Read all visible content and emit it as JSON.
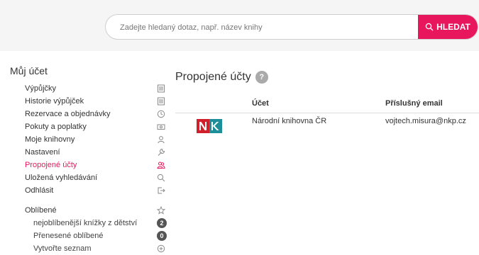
{
  "search": {
    "placeholder": "Zadejte hledaný dotaz, např. název knihy",
    "button_label": "HLEDAT"
  },
  "account": {
    "title": "Můj účet",
    "menu": [
      {
        "label": "Výpůjčky",
        "icon": "ledger-icon",
        "active": false
      },
      {
        "label": "Historie výpůjček",
        "icon": "ledger-icon",
        "active": false
      },
      {
        "label": "Rezervace a objednávky",
        "icon": "clock-icon",
        "active": false
      },
      {
        "label": "Pokuty a poplatky",
        "icon": "banknote-icon",
        "active": false
      },
      {
        "label": "Moje knihovny",
        "icon": "user-icon",
        "active": false
      },
      {
        "label": "Nastavení",
        "icon": "wrench-icon",
        "active": false
      },
      {
        "label": "Propojené účty",
        "icon": "users-icon",
        "active": true
      },
      {
        "label": "Uložená vyhledávání",
        "icon": "search-icon",
        "active": false
      },
      {
        "label": "Odhlásit",
        "icon": "logout-icon",
        "active": false
      }
    ]
  },
  "favorites": {
    "title": "Oblíbené",
    "lists": [
      {
        "label": "nejoblíbenější knížky z dětství",
        "count": "2"
      },
      {
        "label": "Přenesené oblíbené",
        "count": "0"
      }
    ],
    "create_label": "Vytvořte seznam"
  },
  "main": {
    "title": "Propojené účty",
    "help_icon": "?",
    "columns": [
      "Účet",
      "Příslušný email"
    ],
    "rows": [
      {
        "logo": "nk-logo",
        "account": "Národní knihovna ČR",
        "email": "vojtech.misura@nkp.cz"
      }
    ]
  },
  "colors": {
    "accent": "#e8175d",
    "logo_red": "#d21f2c",
    "logo_teal": "#1e8f9a"
  }
}
